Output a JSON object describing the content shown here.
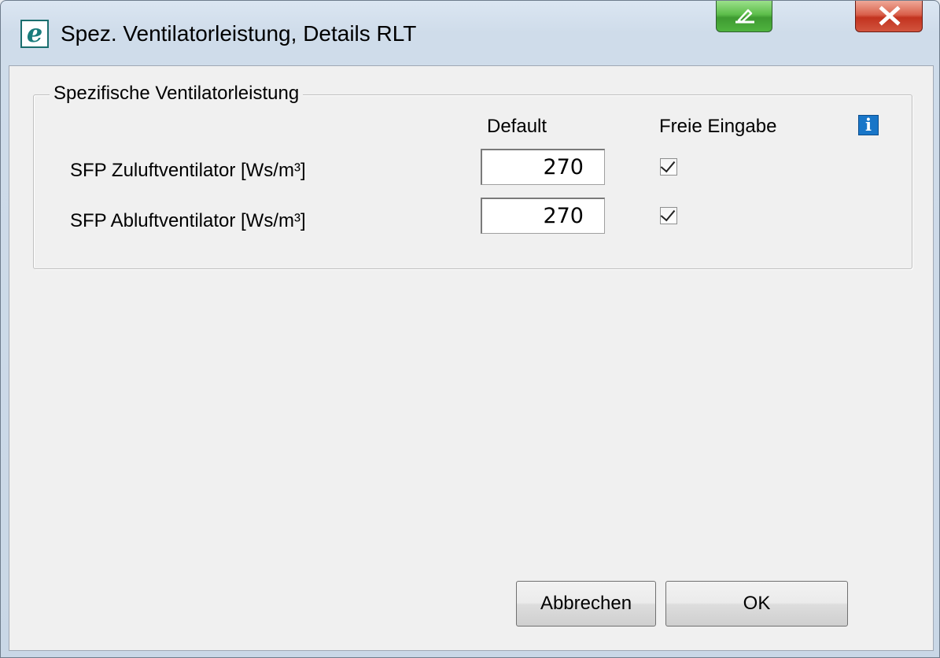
{
  "window": {
    "title": "Spez. Ventilatorleistung, Details RLT",
    "app_icon_letter": "e"
  },
  "titlebar_buttons": {
    "minimize_icon": "pen-minimize-icon",
    "close_icon": "close-icon"
  },
  "group": {
    "legend": "Spezifische Ventilatorleistung",
    "col_default": "Default",
    "col_freie_eingabe": "Freie Eingabe",
    "info_icon": "info-icon",
    "info_glyph": "i",
    "rows": [
      {
        "label": "SFP Zuluftventilator [Ws/m³]",
        "value": "270",
        "freie_eingabe_checked": true
      },
      {
        "label": "SFP Abluftventilator [Ws/m³]",
        "value": "270",
        "freie_eingabe_checked": true
      }
    ]
  },
  "buttons": {
    "cancel": "Abbrechen",
    "ok": "OK"
  },
  "colors": {
    "minimize_button": "#5cbd4a",
    "close_button": "#c2331f",
    "info_icon": "#1976c8",
    "dialog_background": "#f0f0f0"
  }
}
